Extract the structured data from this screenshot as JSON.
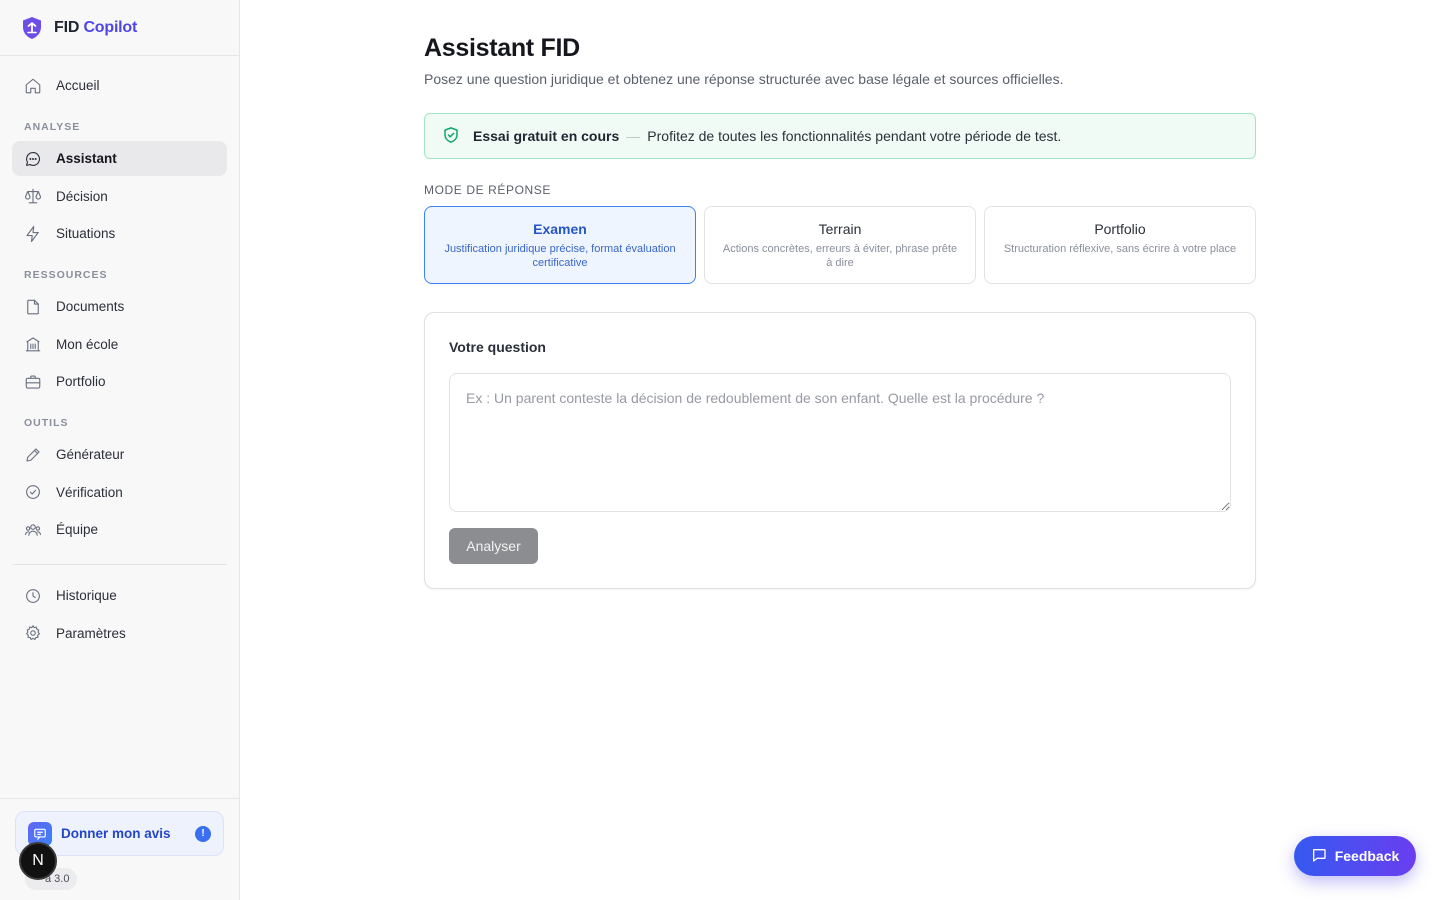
{
  "brand": {
    "name_part1": "FID",
    "name_part2": "Copilot",
    "logo_icon": "shield-logo-icon"
  },
  "sidebar": {
    "top_items": [
      {
        "label": "Accueil",
        "icon": "home-icon"
      }
    ],
    "sections": [
      {
        "label": "ANALYSE",
        "items": [
          {
            "label": "Assistant",
            "icon": "chat-bubble-icon",
            "active": true
          },
          {
            "label": "Décision",
            "icon": "scales-icon"
          },
          {
            "label": "Situations",
            "icon": "lightning-icon"
          }
        ]
      },
      {
        "label": "RESSOURCES",
        "items": [
          {
            "label": "Documents",
            "icon": "document-icon"
          },
          {
            "label": "Mon école",
            "icon": "building-icon"
          },
          {
            "label": "Portfolio",
            "icon": "briefcase-icon"
          }
        ]
      },
      {
        "label": "OUTILS",
        "items": [
          {
            "label": "Générateur",
            "icon": "pencil-icon"
          },
          {
            "label": "Vérification",
            "icon": "check-circle-icon"
          },
          {
            "label": "Équipe",
            "icon": "users-icon"
          }
        ]
      }
    ],
    "bottom_items": [
      {
        "label": "Historique",
        "icon": "clock-icon"
      },
      {
        "label": "Paramètres",
        "icon": "gear-icon"
      }
    ],
    "feedback_card": {
      "label": "Donner mon avis",
      "badge": "!"
    },
    "version": "a 3.0",
    "user_badge": "N"
  },
  "main": {
    "title": "Assistant FID",
    "subtitle": "Posez une question juridique et obtenez une réponse structurée avec base légale et sources officielles.",
    "trial": {
      "strong": "Essai gratuit en cours",
      "separator": "—",
      "text": "Profitez de toutes les fonctionnalités pendant votre période de test."
    },
    "mode_label": "MODE DE RÉPONSE",
    "modes": [
      {
        "title": "Examen",
        "desc": "Justification juridique précise, format évaluation certificative",
        "active": true
      },
      {
        "title": "Terrain",
        "desc": "Actions concrètes, erreurs à éviter, phrase prête à dire"
      },
      {
        "title": "Portfolio",
        "desc": "Structuration réflexive, sans écrire à votre place"
      }
    ],
    "question": {
      "label": "Votre question",
      "value": "",
      "placeholder": "Ex : Un parent conteste la décision de redoublement de son enfant. Quelle est la procédure ?",
      "submit_label": "Analyser"
    }
  },
  "floating_feedback": {
    "label": "Feedback"
  },
  "colors": {
    "accent": "#4f46e5",
    "active_mode": "#3b82f6",
    "trial_border": "#a5e3c8",
    "trial_icon": "#10a66e"
  }
}
